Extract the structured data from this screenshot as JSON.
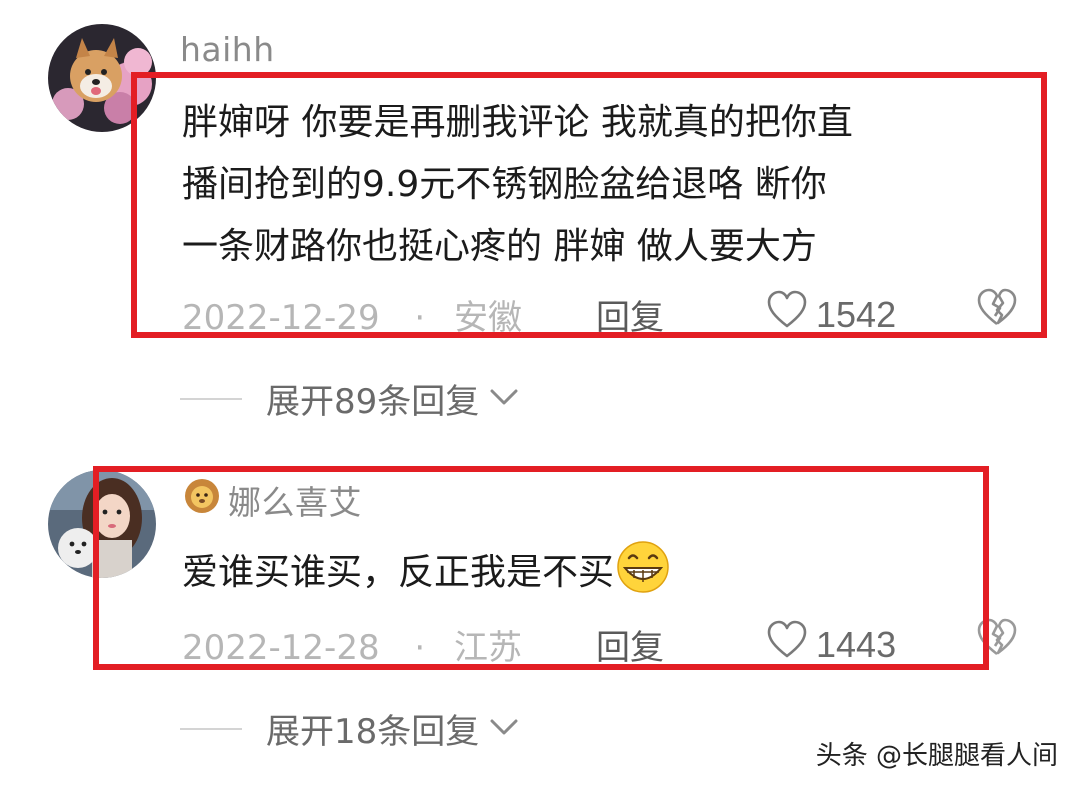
{
  "comments": [
    {
      "username": "haihh",
      "lines": [
        "胖婶呀  你要是再删我评论 我就真的把你直",
        "播间抢到的9.9元不锈钢脸盆给退咯  断你",
        "一条财路你也挺心疼的  胖婶 做人要大方"
      ],
      "date": "2022-12-29",
      "dot": "·",
      "location": "安徽",
      "reply_label": "回复",
      "likes": "1542",
      "expand_label": "展开89条回复"
    },
    {
      "username": "娜么喜艾",
      "lines": [
        "爱谁买谁买，反正我是不买"
      ],
      "date": "2022-12-28",
      "dot": "·",
      "location": "江苏",
      "reply_label": "回复",
      "likes": "1443",
      "expand_label": "展开18条回复"
    }
  ],
  "watermark": "头条 @长腿腿看人间",
  "colors": {
    "highlight_box": "#e31e24"
  },
  "icons": [
    "heart-icon",
    "broken-heart-icon",
    "chevron-down-icon",
    "grinning-emoji-icon",
    "lion-badge-icon"
  ]
}
